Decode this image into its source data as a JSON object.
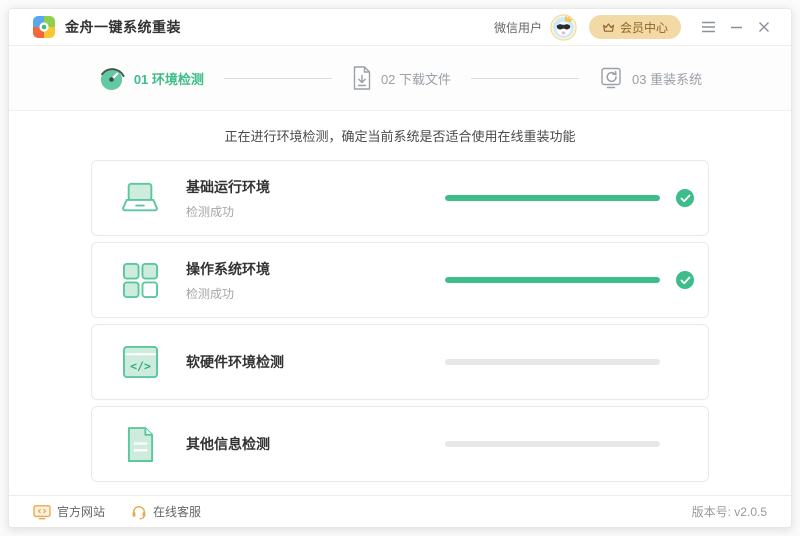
{
  "titlebar": {
    "app_title": "金舟一键系统重装",
    "user_label": "微信用户",
    "member_center_label": "会员中心"
  },
  "steps": [
    {
      "number": "01",
      "label": "环境检测",
      "active": true,
      "icon": "gauge-icon"
    },
    {
      "number": "02",
      "label": "下载文件",
      "active": false,
      "icon": "download-file-icon"
    },
    {
      "number": "03",
      "label": "重装系统",
      "active": false,
      "icon": "monitor-refresh-icon"
    }
  ],
  "status_message": "正在进行环境检测，确定当前系统是否适合使用在线重装功能",
  "checks": [
    {
      "title": "基础运行环境",
      "subtitle": "检测成功",
      "progress": 100,
      "done": true,
      "icon": "laptop-icon"
    },
    {
      "title": "操作系统环境",
      "subtitle": "检测成功",
      "progress": 100,
      "done": true,
      "icon": "grid-icon"
    },
    {
      "title": "软硬件环境检测",
      "subtitle": "",
      "progress": 0,
      "done": false,
      "icon": "code-window-icon"
    },
    {
      "title": "其他信息检测",
      "subtitle": "",
      "progress": 0,
      "done": false,
      "icon": "document-icon"
    }
  ],
  "footer": {
    "website_label": "官方网站",
    "support_label": "在线客服",
    "version_label": "版本号: v2.0.5"
  },
  "colors": {
    "accent_green": "#3dbd8a",
    "icon_green_stroke": "#5bc79d",
    "icon_green_fill": "#cdecdd",
    "pending_gray": "#e7e7e7",
    "member_bg": "#f2d9a6",
    "member_text": "#8d6628",
    "footer_orange": "#e9a950"
  }
}
